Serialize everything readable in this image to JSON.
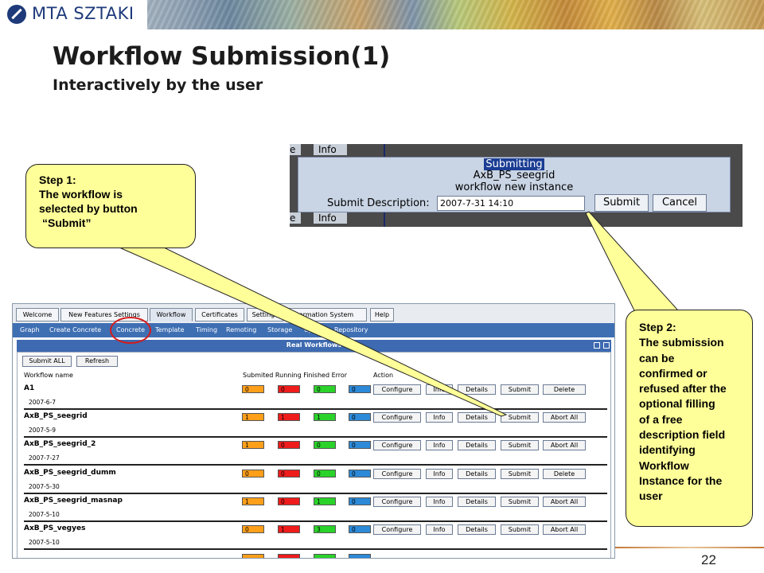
{
  "logo": {
    "text": "MTA SZTAKI"
  },
  "slide": {
    "title": "Workflow Submission(1)",
    "subtitle": "Interactively by the user",
    "page_number": "22"
  },
  "callout1": {
    "lines": [
      "Step 1:",
      "The workflow is",
      "selected by button",
      "“Submit”"
    ]
  },
  "callout2": {
    "lines": [
      "Step 2:",
      "The submission",
      "can be",
      "confirmed or",
      "refused after the",
      "optional filling",
      "of a free",
      "description field",
      "identifying",
      "Workflow",
      "Instance for the",
      "user"
    ]
  },
  "dialog": {
    "bg_tab_e": "e",
    "bg_tab_info": "Info",
    "line1": "Submitting",
    "line2": "AxB_PS_seegrid",
    "line3": "workflow new instance",
    "label": "Submit Description:",
    "input_value": "2007-7-31 14:10",
    "submit_label": "Submit",
    "cancel_label": "Cancel"
  },
  "portal": {
    "tabs": [
      "Welcome",
      "New Features Settings",
      "Workflow",
      "Certificates",
      "Settings",
      "ormation System",
      "Help"
    ],
    "active_tab": "Workflow",
    "subnav": [
      "Graph",
      "Create Concrete",
      "Concrete",
      "Template",
      "Timing",
      "Remoting",
      "Storage",
      "Upl",
      "Repository"
    ],
    "panel_title": "Real Workflows",
    "submit_all_label": "Submit ALL",
    "refresh_label": "Refresh",
    "headers": {
      "name": "Workflow name",
      "status": "Submited Running Finished Error",
      "action": "Action"
    },
    "workflows": [
      {
        "name": "A1",
        "date": "2007-6-7",
        "submitted": "0",
        "running": "0",
        "finished": "0",
        "error": "0",
        "actions": [
          "Configure",
          "Info",
          "Details",
          "Submit",
          "Delete"
        ]
      },
      {
        "name": "AxB_PS_seegrid",
        "date": "2007-5-9",
        "submitted": "1",
        "running": "1",
        "finished": "1",
        "error": "0",
        "actions": [
          "Configure",
          "Info",
          "Details",
          "Submit",
          "Abort All"
        ]
      },
      {
        "name": "AxB_PS_seegrid_2",
        "date": "2007-7-27",
        "submitted": "1",
        "running": "0",
        "finished": "0",
        "error": "0",
        "actions": [
          "Configure",
          "Info",
          "Details",
          "Submit",
          "Abort All"
        ]
      },
      {
        "name": "AxB_PS_seegrid_dumm",
        "date": "2007-5-30",
        "submitted": "0",
        "running": "0",
        "finished": "0",
        "error": "0",
        "actions": [
          "Configure",
          "Info",
          "Details",
          "Submit",
          "Delete"
        ]
      },
      {
        "name": "AxB_PS_seegrid_masnap",
        "date": "2007-5-10",
        "submitted": "1",
        "running": "0",
        "finished": "1",
        "error": "0",
        "actions": [
          "Configure",
          "Info",
          "Details",
          "Submit",
          "Abort All"
        ]
      },
      {
        "name": "AxB_PS_vegyes",
        "date": "2007-5-10",
        "submitted": "0",
        "running": "1",
        "finished": "3",
        "error": "0",
        "actions": [
          "Configure",
          "Info",
          "Details",
          "Submit",
          "Abort All"
        ]
      }
    ],
    "status_colors": {
      "submitted": "#ff9f1a",
      "running": "#ef1c1c",
      "finished": "#2ad22a",
      "error": "#2c8ad8"
    }
  },
  "colors": {
    "callout_fill": "#ffff99",
    "highlight_oval": "#d41b1b",
    "portal_blue": "#3d6ab0"
  }
}
